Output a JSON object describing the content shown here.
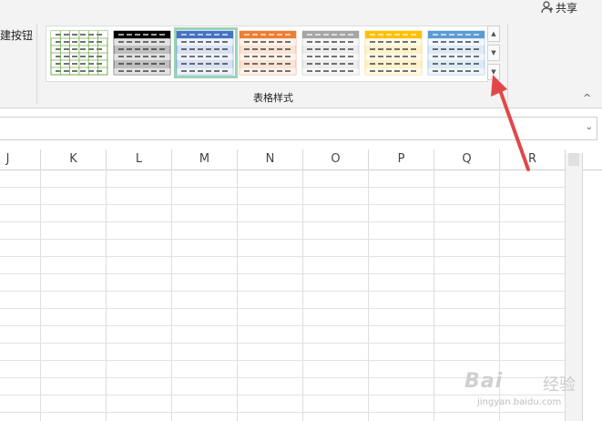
{
  "ribbon": {
    "left_partial_label": "建按钮",
    "group_label": "表格样式",
    "share_label": "共享",
    "scroll_up": "▲",
    "scroll_down": "▼",
    "scroll_more": "▼",
    "launcher": "↘",
    "collapse": "^"
  },
  "table_styles": [
    {
      "name": "green-light",
      "accent": "#70ad47",
      "fill": "#ffffff"
    },
    {
      "name": "black-dark",
      "accent": "#000000",
      "fill": "#bfbfbf"
    },
    {
      "name": "blue-medium",
      "accent": "#4472c4",
      "fill": "#d9e2f3",
      "selected": true
    },
    {
      "name": "orange-medium",
      "accent": "#ed7d31",
      "fill": "#fbe4d5"
    },
    {
      "name": "gray-medium",
      "accent": "#a5a5a5",
      "fill": "#ededed"
    },
    {
      "name": "gold-medium",
      "accent": "#ffc000",
      "fill": "#fff2cc"
    },
    {
      "name": "lightblue-medium",
      "accent": "#5b9bd5",
      "fill": "#deebf6"
    }
  ],
  "formula_bar": {
    "dropdown": "⌄"
  },
  "columns": [
    "J",
    "K",
    "L",
    "M",
    "N",
    "O",
    "P",
    "Q",
    "R"
  ],
  "annotation": {
    "arrow_color": "#e04848"
  },
  "watermark": {
    "brand": "Bai",
    "word": "经验",
    "sub": "jingyan.baidu.com"
  }
}
